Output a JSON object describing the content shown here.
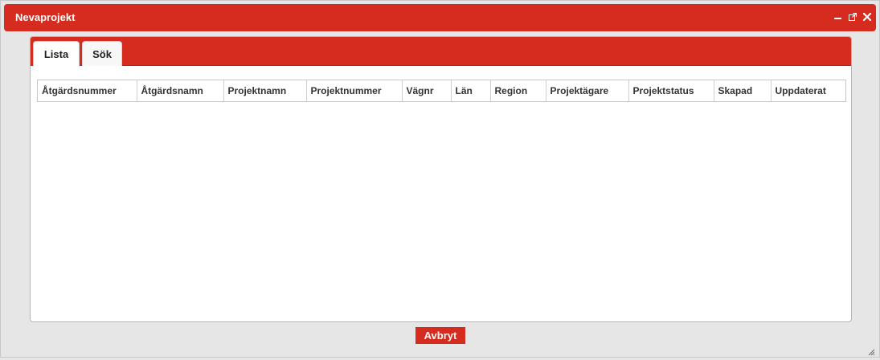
{
  "window": {
    "title": "Nevaprojekt",
    "controls": {
      "minimize_icon": "minimize-icon",
      "popout_icon": "external-window-icon",
      "close_icon": "close-icon"
    }
  },
  "tabs": [
    {
      "label": "Lista",
      "active": true
    },
    {
      "label": "Sök",
      "active": false
    }
  ],
  "table": {
    "columns": [
      "Åtgärdsnummer",
      "Åtgärdsnamn",
      "Projektnamn",
      "Projektnummer",
      "Vägnr",
      "Län",
      "Region",
      "Projektägare",
      "Projektstatus",
      "Skapad",
      "Uppdaterat"
    ],
    "rows": []
  },
  "footer": {
    "cancel_label": "Avbryt"
  },
  "colors": {
    "accent": "#d62b1f",
    "background": "#e6e6e6",
    "panel": "#ffffff"
  }
}
